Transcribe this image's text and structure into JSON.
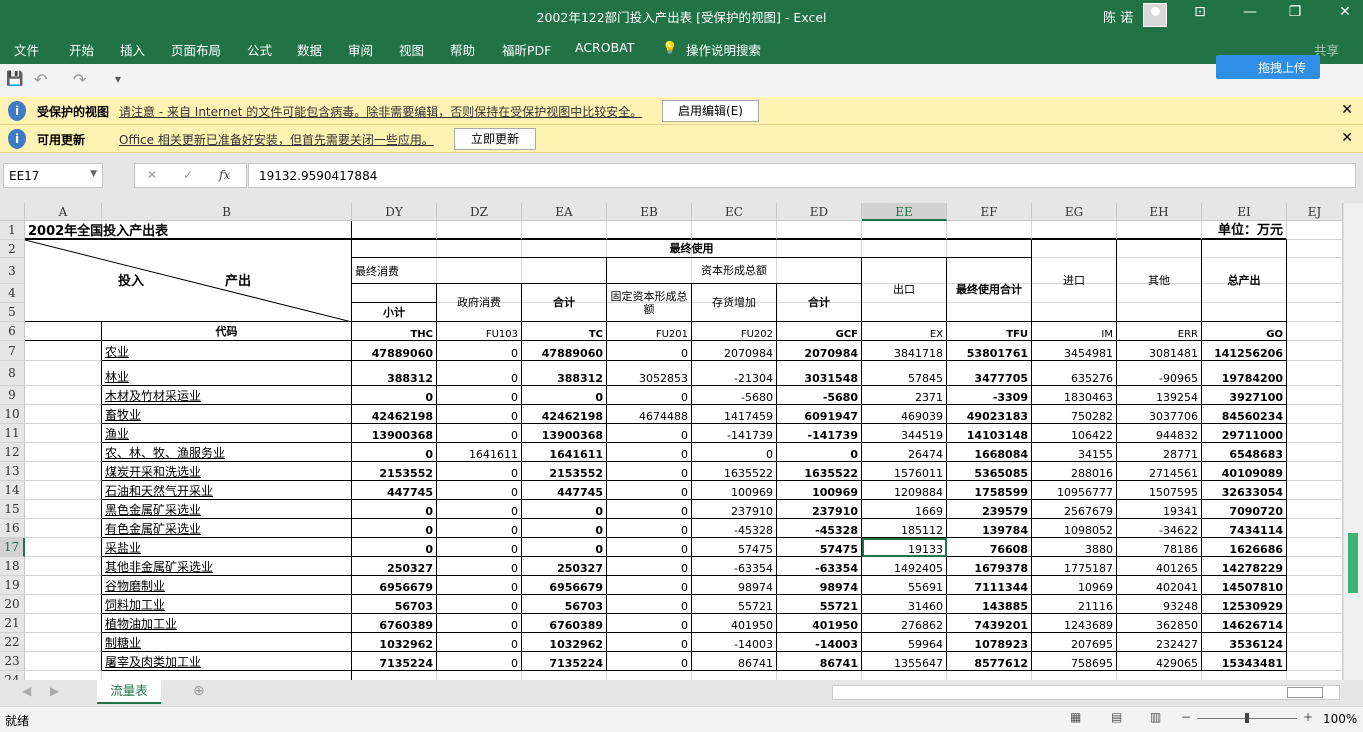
{
  "window": {
    "title": "2002年122部门投入产出表  [受保护的视图]  -  Excel",
    "user": "陈 诺",
    "minimize": "—",
    "restore": "❐",
    "close": "✕",
    "ribbon_display": "⊡"
  },
  "ribbon": {
    "tabs": [
      "文件",
      "开始",
      "插入",
      "页面布局",
      "公式",
      "数据",
      "审阅",
      "视图",
      "帮助",
      "福昕PDF",
      "ACROBAT"
    ],
    "tell_me": "操作说明搜索",
    "share": "共享",
    "upload": "拖拽上传"
  },
  "qat": {
    "save": "💾",
    "undo": "↶",
    "redo": "↷",
    "customize": "▾"
  },
  "protected_bar": {
    "title": "受保护的视图",
    "message": "请注意 - 来自 Internet 的文件可能包含病毒。除非需要编辑，否则保持在受保护视图中比较安全。",
    "button": "启用编辑(E)"
  },
  "update_bar": {
    "title": "可用更新",
    "message": "Office 相关更新已准备好安装，但首先需要关闭一些应用。",
    "button": "立即更新"
  },
  "formula_bar": {
    "name_box": "EE17",
    "cancel": "✕",
    "enter": "✓",
    "fx": "fx",
    "value": "19132.9590417884"
  },
  "columns": [
    "A",
    "B",
    "DY",
    "DZ",
    "EA",
    "EB",
    "EC",
    "ED",
    "EE",
    "EF",
    "EG",
    "EH",
    "EI",
    "EJ"
  ],
  "row_numbers": [
    "1",
    "2",
    "3",
    "4",
    "5",
    "6",
    "7",
    "8",
    "9",
    "10",
    "11",
    "12",
    "13",
    "14",
    "15",
    "16",
    "17",
    "18",
    "19",
    "20",
    "21",
    "22",
    "23",
    "24"
  ],
  "sheet": {
    "title": "2002年全国投入产出表",
    "unit": "单位：万元",
    "input": "投入",
    "output": "产出",
    "final_use": "最终使用",
    "final_consumption": "最终消费",
    "capital_formation": "资本形成总额",
    "export": "出口",
    "final_use_total": "最终使用合计",
    "import": "进口",
    "other": "其他",
    "total_output": "总产出",
    "subtotal": "小计",
    "gov_consumption": "政府消费",
    "total1": "合计",
    "fixed_capital": "固定资本形成总额",
    "inventory": "存货增加",
    "total2": "合计",
    "code_label": "代码",
    "codes": [
      "THC",
      "FU103",
      "TC",
      "FU201",
      "FU202",
      "GCF",
      "EX",
      "TFU",
      "IM",
      "ERR",
      "GO"
    ],
    "rows": [
      {
        "name": "农业",
        "v": [
          "47889060",
          "0",
          "47889060",
          "0",
          "2070984",
          "2070984",
          "3841718",
          "53801761",
          "3454981",
          "3081481",
          "141256206"
        ]
      },
      {
        "name": "林业",
        "v": [
          "388312",
          "0",
          "388312",
          "3052853",
          "-21304",
          "3031548",
          "57845",
          "3477705",
          "635276",
          "-90965",
          "19784200"
        ]
      },
      {
        "name": "木材及竹材采运业",
        "v": [
          "0",
          "0",
          "0",
          "0",
          "-5680",
          "-5680",
          "2371",
          "-3309",
          "1830463",
          "139254",
          "3927100"
        ]
      },
      {
        "name": "畜牧业",
        "v": [
          "42462198",
          "0",
          "42462198",
          "4674488",
          "1417459",
          "6091947",
          "469039",
          "49023183",
          "750282",
          "3037706",
          "84560234"
        ]
      },
      {
        "name": "渔业",
        "v": [
          "13900368",
          "0",
          "13900368",
          "0",
          "-141739",
          "-141739",
          "344519",
          "14103148",
          "106422",
          "944832",
          "29711000"
        ]
      },
      {
        "name": "农、林、牧、渔服务业",
        "v": [
          "0",
          "1641611",
          "1641611",
          "0",
          "0",
          "0",
          "26474",
          "1668084",
          "34155",
          "28771",
          "6548683"
        ]
      },
      {
        "name": "煤炭开采和洗选业",
        "v": [
          "2153552",
          "0",
          "2153552",
          "0",
          "1635522",
          "1635522",
          "1576011",
          "5365085",
          "288016",
          "2714561",
          "40109089"
        ]
      },
      {
        "name": "石油和天然气开采业",
        "v": [
          "447745",
          "0",
          "447745",
          "0",
          "100969",
          "100969",
          "1209884",
          "1758599",
          "10956777",
          "1507595",
          "32633054"
        ]
      },
      {
        "name": "黑色金属矿采选业",
        "v": [
          "0",
          "0",
          "0",
          "0",
          "237910",
          "237910",
          "1669",
          "239579",
          "2567679",
          "19341",
          "7090720"
        ]
      },
      {
        "name": "有色金属矿采选业",
        "v": [
          "0",
          "0",
          "0",
          "0",
          "-45328",
          "-45328",
          "185112",
          "139784",
          "1098052",
          "-34622",
          "7434114"
        ]
      },
      {
        "name": "采盐业",
        "v": [
          "0",
          "0",
          "0",
          "0",
          "57475",
          "57475",
          "19133",
          "76608",
          "3880",
          "78186",
          "1626686"
        ]
      },
      {
        "name": "其他非金属矿采选业",
        "v": [
          "250327",
          "0",
          "250327",
          "0",
          "-63354",
          "-63354",
          "1492405",
          "1679378",
          "1775187",
          "401265",
          "14278229"
        ]
      },
      {
        "name": "谷物磨制业",
        "v": [
          "6956679",
          "0",
          "6956679",
          "0",
          "98974",
          "98974",
          "55691",
          "7111344",
          "10969",
          "402041",
          "14507810"
        ]
      },
      {
        "name": "饲料加工业",
        "v": [
          "56703",
          "0",
          "56703",
          "0",
          "55721",
          "55721",
          "31460",
          "143885",
          "21116",
          "93248",
          "12530929"
        ]
      },
      {
        "name": "植物油加工业",
        "v": [
          "6760389",
          "0",
          "6760389",
          "0",
          "401950",
          "401950",
          "276862",
          "7439201",
          "1243689",
          "362850",
          "14626714"
        ]
      },
      {
        "name": "制糖业",
        "v": [
          "1032962",
          "0",
          "1032962",
          "0",
          "-14003",
          "-14003",
          "59964",
          "1078923",
          "207695",
          "232427",
          "3536124"
        ]
      },
      {
        "name": "屠宰及肉类加工业",
        "v": [
          "7135224",
          "0",
          "7135224",
          "0",
          "86741",
          "86741",
          "1355647",
          "8577612",
          "758695",
          "429065",
          "15343481"
        ]
      }
    ]
  },
  "sheet_tabs": [
    "流量表"
  ],
  "status": {
    "ready": "就绪",
    "zoom": "100%"
  },
  "colors": {
    "accent": "#217346",
    "bar": "#fff3b4"
  }
}
